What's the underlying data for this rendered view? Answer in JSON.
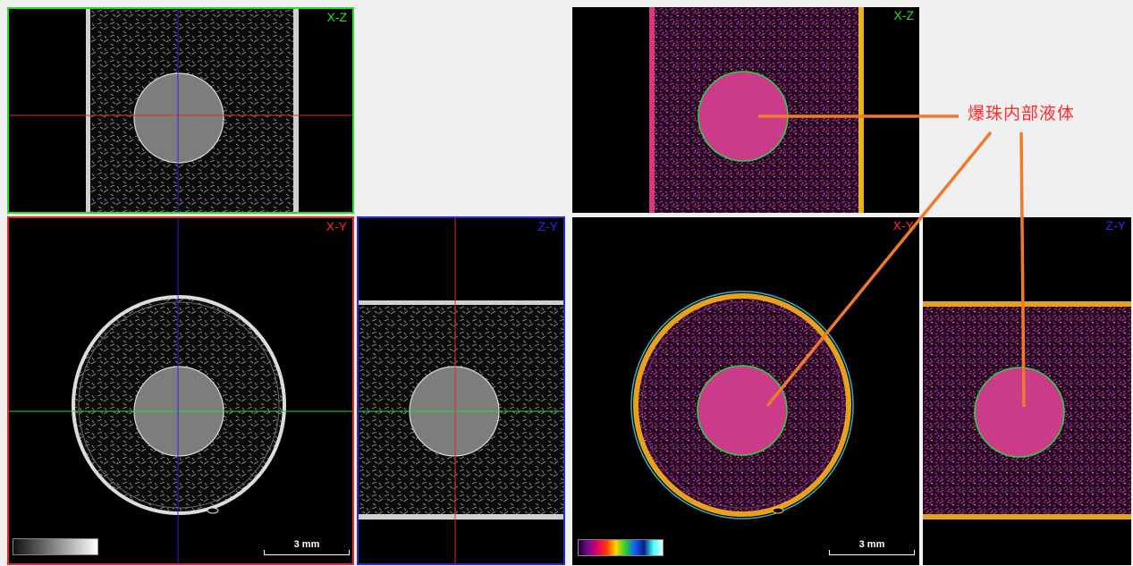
{
  "views": {
    "left_xz": {
      "label": "X-Z"
    },
    "left_xy": {
      "label": "X-Y"
    },
    "left_zy": {
      "label": "Z-Y"
    },
    "right_xz": {
      "label": "X-Z"
    },
    "right_xy": {
      "label": "X-Y"
    },
    "right_zy": {
      "label": "Z-Y"
    }
  },
  "scalebars": {
    "left": "3 mm",
    "right": "3 mm"
  },
  "annotation": {
    "text": "爆珠内部液体"
  },
  "colors": {
    "xz_frame": "#22e022",
    "xy_frame": "#e02b2b",
    "zy_frame": "#2a2acf",
    "annotation_text": "#ff2a2a",
    "leader_line": "#f07a2a",
    "capsule_fill_color": "#cc3a8a",
    "capsule_fill_gray": "#7a7a7a"
  },
  "colorbars": {
    "left": "grayscale",
    "right": "hue"
  }
}
